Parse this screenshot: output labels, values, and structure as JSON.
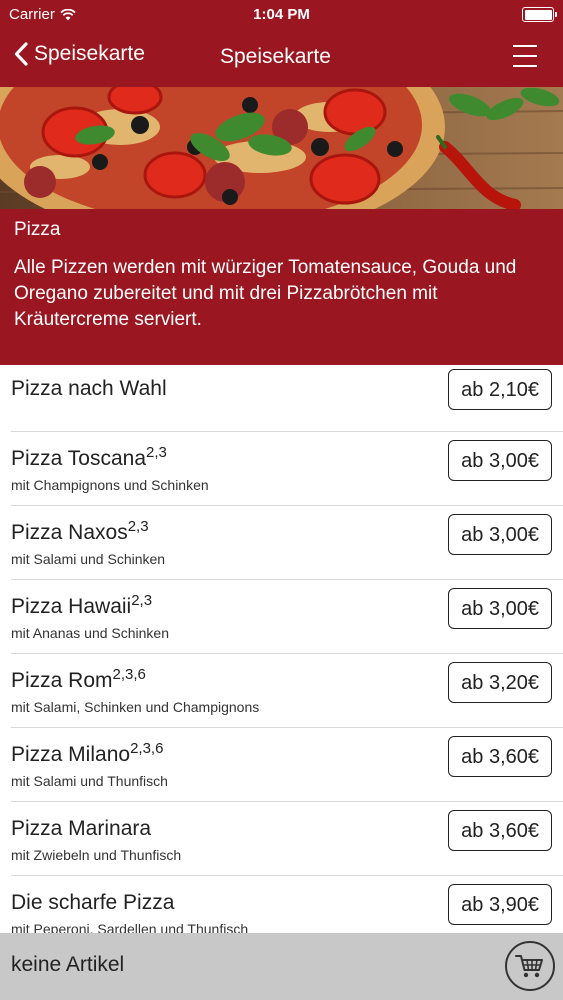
{
  "status_bar": {
    "carrier": "Carrier",
    "time": "1:04 PM",
    "wifi_icon": "wifi-icon",
    "battery_icon": "battery-icon"
  },
  "nav": {
    "back_label": "Speisekarte",
    "title": "Speisekarte",
    "back_icon": "chevron-left-icon",
    "menu_icon": "hamburger-menu-icon"
  },
  "hero_image": "pizza-photo",
  "category": {
    "title": "Pizza",
    "description": "Alle Pizzen werden mit würziger Tomatensauce, Gouda und Oregano zubereitet und mit drei Pizzabrötchen mit Kräutercreme serviert."
  },
  "items": [
    {
      "name": "Pizza nach Wahl",
      "sup": "",
      "desc": "",
      "price": "ab 2,10€"
    },
    {
      "name": "Pizza Toscana",
      "sup": "2,3",
      "desc": "mit Champignons und Schinken",
      "price": "ab 3,00€"
    },
    {
      "name": "Pizza Naxos",
      "sup": "2,3",
      "desc": "mit Salami und Schinken",
      "price": "ab 3,00€"
    },
    {
      "name": "Pizza Hawaii",
      "sup": "2,3",
      "desc": "mit Ananas und Schinken",
      "price": "ab 3,00€"
    },
    {
      "name": "Pizza Rom",
      "sup": "2,3,6",
      "desc": "mit Salami, Schinken und Champignons",
      "price": "ab 3,20€"
    },
    {
      "name": "Pizza Milano",
      "sup": "2,3,6",
      "desc": "mit Salami und Thunfisch",
      "price": "ab 3,60€"
    },
    {
      "name": "Pizza Marinara",
      "sup": "",
      "desc": "mit Zwiebeln und Thunfisch",
      "price": "ab 3,60€"
    },
    {
      "name": "Die scharfe Pizza",
      "sup": "",
      "desc": "mit Peperoni, Sardellen und Thunfisch",
      "price": "ab 3,90€"
    }
  ],
  "cart": {
    "label": "keine Artikel",
    "icon": "shopping-cart-icon"
  },
  "colors": {
    "brand": "#9a1620",
    "cart_bar": "#c8c8c8",
    "divider": "#d9d9d9"
  }
}
